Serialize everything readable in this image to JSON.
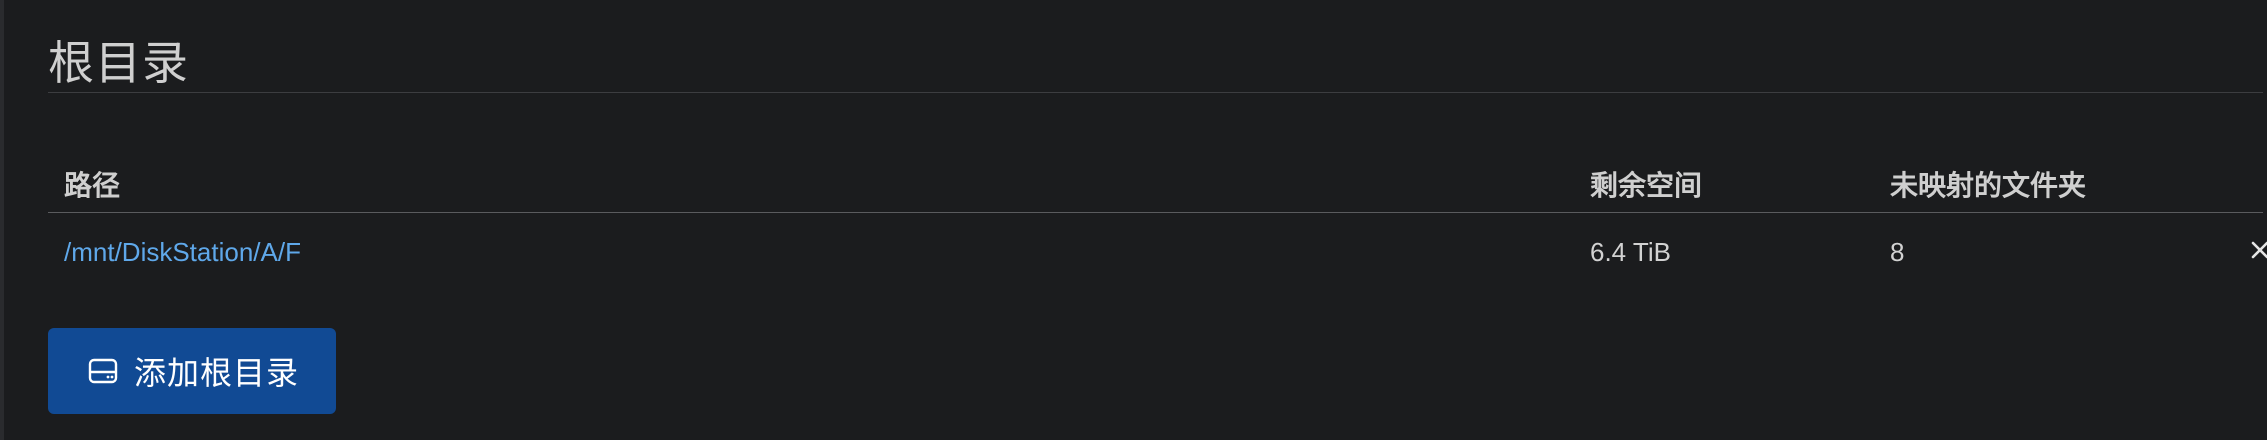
{
  "section": {
    "title": "根目录"
  },
  "table": {
    "headers": {
      "path": "路径",
      "free_space": "剩余空间",
      "unmapped_folders": "未映射的文件夹"
    },
    "rows": [
      {
        "path": "/mnt/DiskStation/A/F",
        "free_space": "6.4 TiB",
        "unmapped_folders": "8",
        "remove_icon": "close-icon"
      }
    ]
  },
  "actions": {
    "add_root_label": "添加根目录",
    "add_root_icon": "drive-icon"
  },
  "colors": {
    "background": "#1b1c1e",
    "link": "#5fa8ea",
    "primary_button": "#114a94"
  }
}
